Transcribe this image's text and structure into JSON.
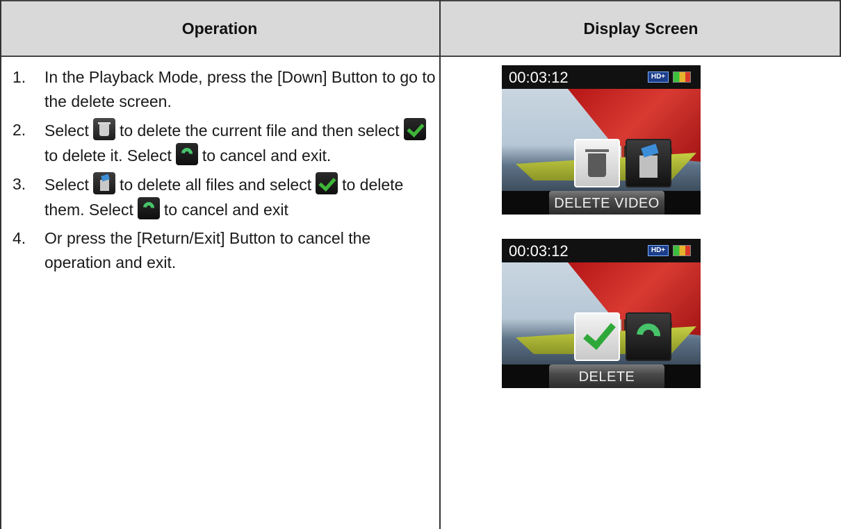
{
  "table": {
    "header": {
      "operation": "Operation",
      "display_screen": "Display Screen"
    }
  },
  "steps": [
    {
      "num": "1.",
      "text": "In the Playback Mode, press the [Down] Button to go to the delete screen."
    },
    {
      "num": "2.",
      "parts": [
        "Select",
        "to delete the current file and then select",
        "to delete it. Select",
        "to cancel and exit."
      ]
    },
    {
      "num": "3.",
      "parts": [
        "Select",
        "to delete all files and select",
        "to delete them. Select",
        "to cancel and exit"
      ]
    },
    {
      "num": "4.",
      "text": "Or press the [Return/Exit] Button to cancel the operation and exit."
    }
  ],
  "icons": {
    "delete_one": "trash-icon",
    "delete_all": "trash-all-icon",
    "confirm": "check-icon",
    "cancel": "return-icon"
  },
  "screens": [
    {
      "time": "00:03:12",
      "badge": "HD+",
      "label": "DELETE VIDEO",
      "options": [
        "trash-icon",
        "trash-all-icon"
      ]
    },
    {
      "time": "00:03:12",
      "badge": "HD+",
      "label": "DELETE",
      "options": [
        "check-icon",
        "return-icon"
      ]
    }
  ]
}
